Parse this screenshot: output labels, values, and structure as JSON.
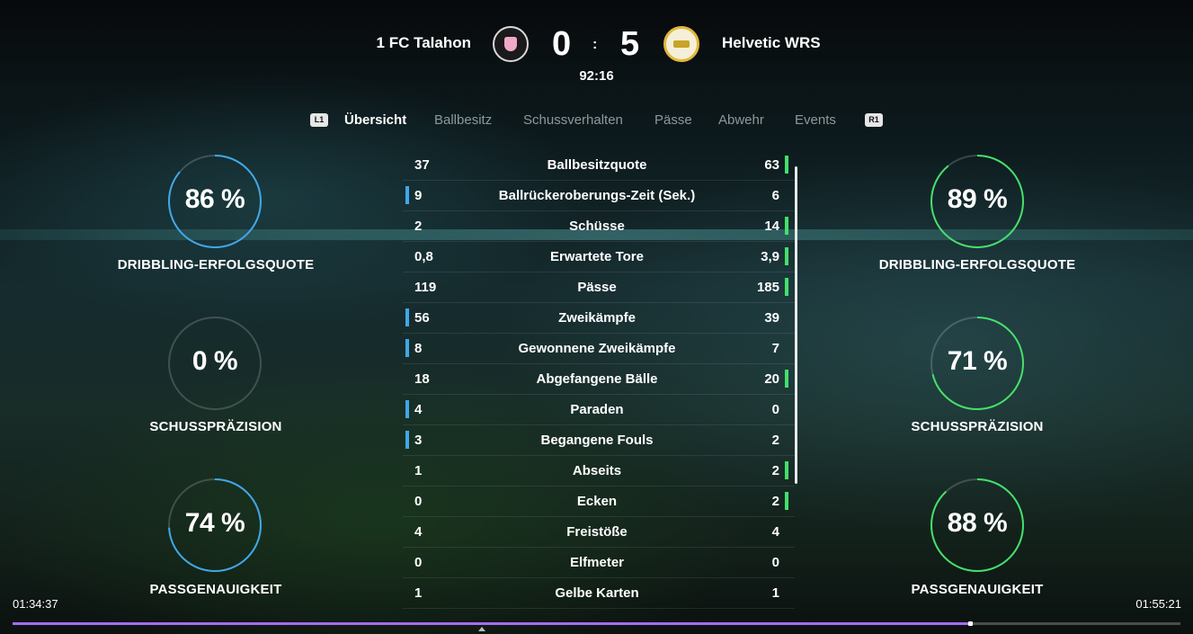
{
  "match": {
    "home_team": "1 FC Talahon",
    "away_team": "Helvetic WRS",
    "home_score": "0",
    "away_score": "5",
    "separator": ":",
    "clock": "92:16"
  },
  "tabs": {
    "left_bumper": "L1",
    "right_bumper": "R1",
    "items": [
      "Übersicht",
      "Ballbesitz",
      "Schussverhalten",
      "Pässe",
      "Abwehr",
      "Events"
    ],
    "active": "Übersicht"
  },
  "home_rings": [
    {
      "value": "86 %",
      "label": "DRIBBLING-ERFOLGSQUOTE",
      "fraction": 0.86
    },
    {
      "value": "0 %",
      "label": "SCHUSSPRÄZISION",
      "fraction": 0.0
    },
    {
      "value": "74 %",
      "label": "PASSGENAUIGKEIT",
      "fraction": 0.74
    }
  ],
  "away_rings": [
    {
      "value": "89 %",
      "label": "DRIBBLING-ERFOLGSQUOTE",
      "fraction": 0.89
    },
    {
      "value": "71 %",
      "label": "SCHUSSPRÄZISION",
      "fraction": 0.71
    },
    {
      "value": "88 %",
      "label": "PASSGENAUIGKEIT",
      "fraction": 0.88
    }
  ],
  "ring_colors": {
    "home": "#3fa8e8",
    "away": "#44e06a",
    "track": "rgba(255,255,255,0.18)"
  },
  "stats": [
    {
      "name": "Ballbesitzquote",
      "home": "37",
      "away": "63",
      "lead": "away"
    },
    {
      "name": "Ballrückeroberungs-Zeit (Sek.)",
      "home": "9",
      "away": "6",
      "lead": "home"
    },
    {
      "name": "Schüsse",
      "home": "2",
      "away": "14",
      "lead": "away"
    },
    {
      "name": "Erwartete Tore",
      "home": "0,8",
      "away": "3,9",
      "lead": "away"
    },
    {
      "name": "Pässe",
      "home": "119",
      "away": "185",
      "lead": "away"
    },
    {
      "name": "Zweikämpfe",
      "home": "56",
      "away": "39",
      "lead": "home"
    },
    {
      "name": "Gewonnene Zweikämpfe",
      "home": "8",
      "away": "7",
      "lead": "home"
    },
    {
      "name": "Abgefangene Bälle",
      "home": "18",
      "away": "20",
      "lead": "away"
    },
    {
      "name": "Paraden",
      "home": "4",
      "away": "0",
      "lead": "home"
    },
    {
      "name": "Begangene Fouls",
      "home": "3",
      "away": "2",
      "lead": "home"
    },
    {
      "name": "Abseits",
      "home": "1",
      "away": "2",
      "lead": "away"
    },
    {
      "name": "Ecken",
      "home": "0",
      "away": "2",
      "lead": "away"
    },
    {
      "name": "Freistöße",
      "home": "4",
      "away": "4",
      "lead": "none"
    },
    {
      "name": "Elfmeter",
      "home": "0",
      "away": "0",
      "lead": "none"
    },
    {
      "name": "Gelbe Karten",
      "home": "1",
      "away": "1",
      "lead": "none"
    }
  ],
  "player": {
    "time_elapsed": "01:34:37",
    "time_total": "01:55:21",
    "progress_fraction": 0.82
  }
}
